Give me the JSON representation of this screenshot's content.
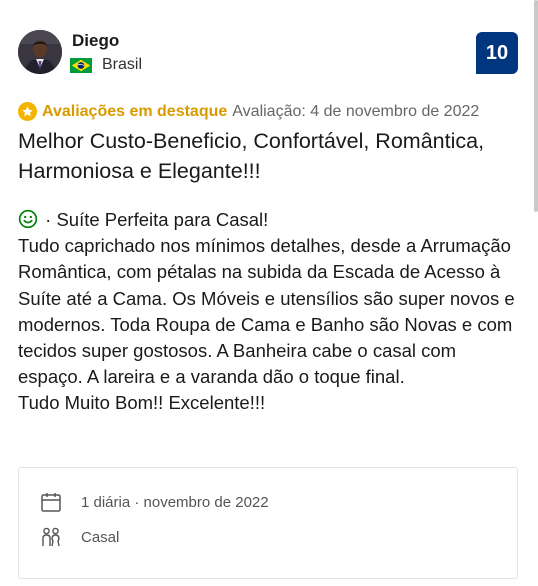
{
  "reviewer": {
    "name": "Diego",
    "country": "Brasil",
    "avatar_icon": "user-avatar-photo",
    "flag_icon": "brazil-flag-icon"
  },
  "score": "10",
  "featured_label": "Avaliações em destaque",
  "review_date": "Avaliação: 4 de novembro de 2022",
  "review_title": "Melhor Custo-Beneficio, Confortável, Romântica, Harmoniosa e Elegante!!!",
  "review_positive_lead": "· Suíte Perfeita para Casal!",
  "review_body": [
    "Tudo caprichado nos mínimos detalhes, desde a Arrumação Romântica, com pétalas na subida da Escada de Acesso à Suíte até a Cama. Os Móveis e utensílios são super novos e modernos. Toda Roupa de Cama e Banho são Novas e com tecidos super gostosos. A Banheira cabe o casal com espaço. A lareira e a varanda dão o toque final.",
    "Tudo Muito Bom!! Excelente!!!"
  ],
  "stay": {
    "duration": "1 diária · novembro de 2022",
    "traveler_type": "Casal"
  },
  "colors": {
    "score_badge": "#003580",
    "featured": "#d99a00",
    "positive_icon": "#008009",
    "star": "#f4b400"
  }
}
